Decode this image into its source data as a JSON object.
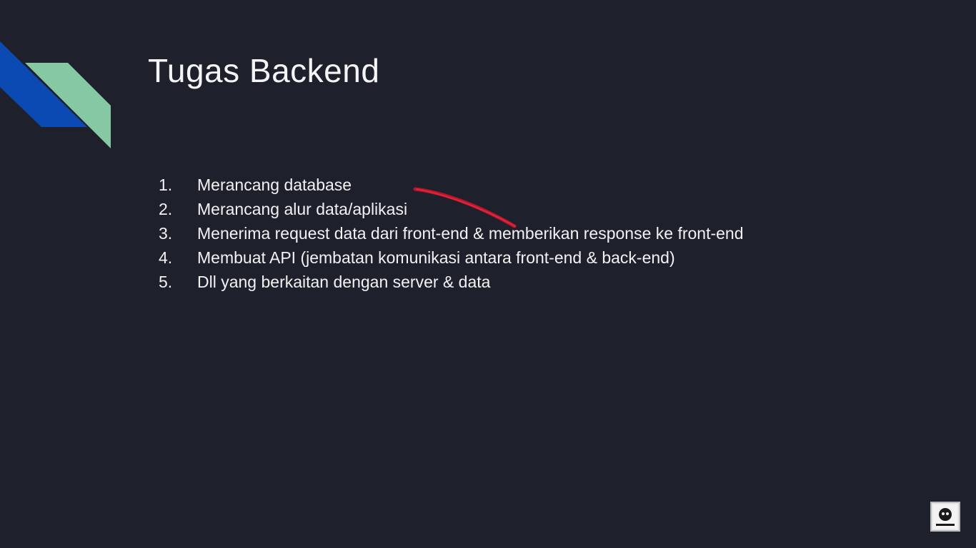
{
  "slide": {
    "title": "Tugas Backend",
    "items": [
      {
        "number": "1.",
        "text": "Merancang database"
      },
      {
        "number": "2.",
        "text": "Merancang alur data/aplikasi"
      },
      {
        "number": "3.",
        "text": "Menerima request data dari front-end & memberikan response ke front-end"
      },
      {
        "number": "4.",
        "text": "Membuat API (jembatan komunikasi antara front-end & back-end)"
      },
      {
        "number": "5.",
        "text": "Dll yang berkaitan dengan server & data"
      }
    ]
  },
  "colors": {
    "background": "#1e202b",
    "accent_blue": "#0b49b3",
    "accent_teal": "#86c7a4",
    "annotation_red": "#d3142b"
  },
  "icons": {
    "watermark": "channel-logo-icon"
  }
}
